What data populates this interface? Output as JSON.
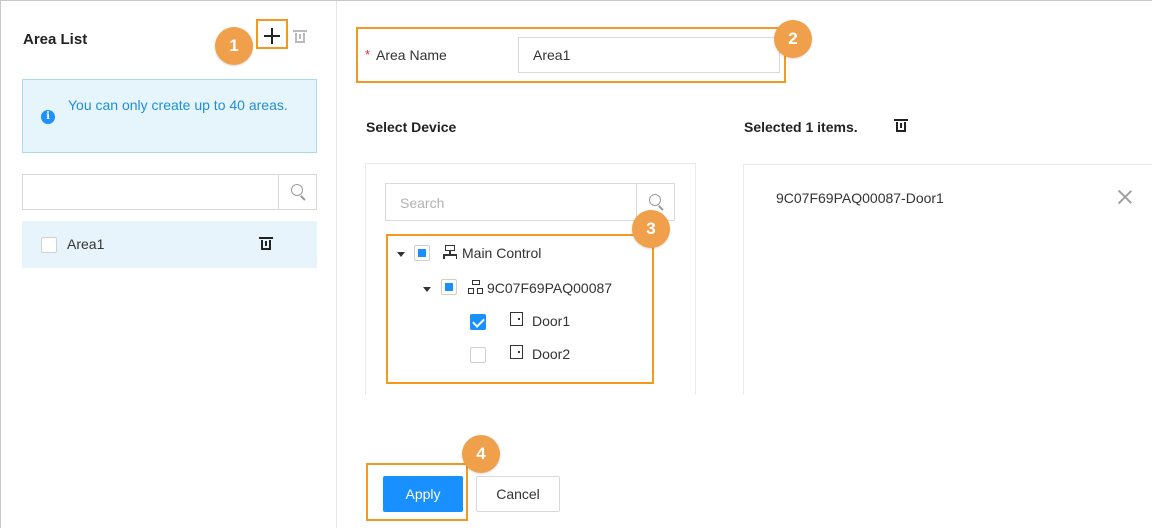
{
  "area_list": {
    "title": "Area List",
    "info_icon": "i",
    "info_message": "You can only create up to 40 areas.",
    "search": {
      "placeholder": "",
      "value": ""
    },
    "items": [
      {
        "label": "Area1",
        "checked": false
      }
    ]
  },
  "form": {
    "required_mark": "*",
    "area_name_label": "Area Name",
    "area_name_value": "Area1",
    "select_device_title": "Select Device",
    "selected_title": "Selected 1 items.",
    "search_placeholder": "Search"
  },
  "tree": {
    "root": {
      "label": "Main Control",
      "expanded": true,
      "state": "partial"
    },
    "device": {
      "label": "9C07F69PAQ00087",
      "expanded": true,
      "state": "partial"
    },
    "doors": [
      {
        "label": "Door1",
        "checked": true
      },
      {
        "label": "Door2",
        "checked": false
      }
    ]
  },
  "selected_items": [
    {
      "label": "9C07F69PAQ00087-Door1"
    }
  ],
  "actions": {
    "apply_label": "Apply",
    "cancel_label": "Cancel"
  },
  "callouts": [
    "1",
    "2",
    "3",
    "4"
  ],
  "icons": {
    "add": "plus-icon",
    "delete": "trash-icon",
    "search": "search-icon",
    "info": "info-icon",
    "network": "network-icon",
    "device": "device-icon",
    "door": "door-icon",
    "remove": "close-icon",
    "caret": "caret-down-icon"
  },
  "colors": {
    "accent": "#1890ff",
    "annotation": "#f39a1e",
    "badge": "#f0a04b",
    "info_bg": "#e6f5fb",
    "info_text": "#1e8fd6",
    "selected_row": "#e8f4fc"
  }
}
